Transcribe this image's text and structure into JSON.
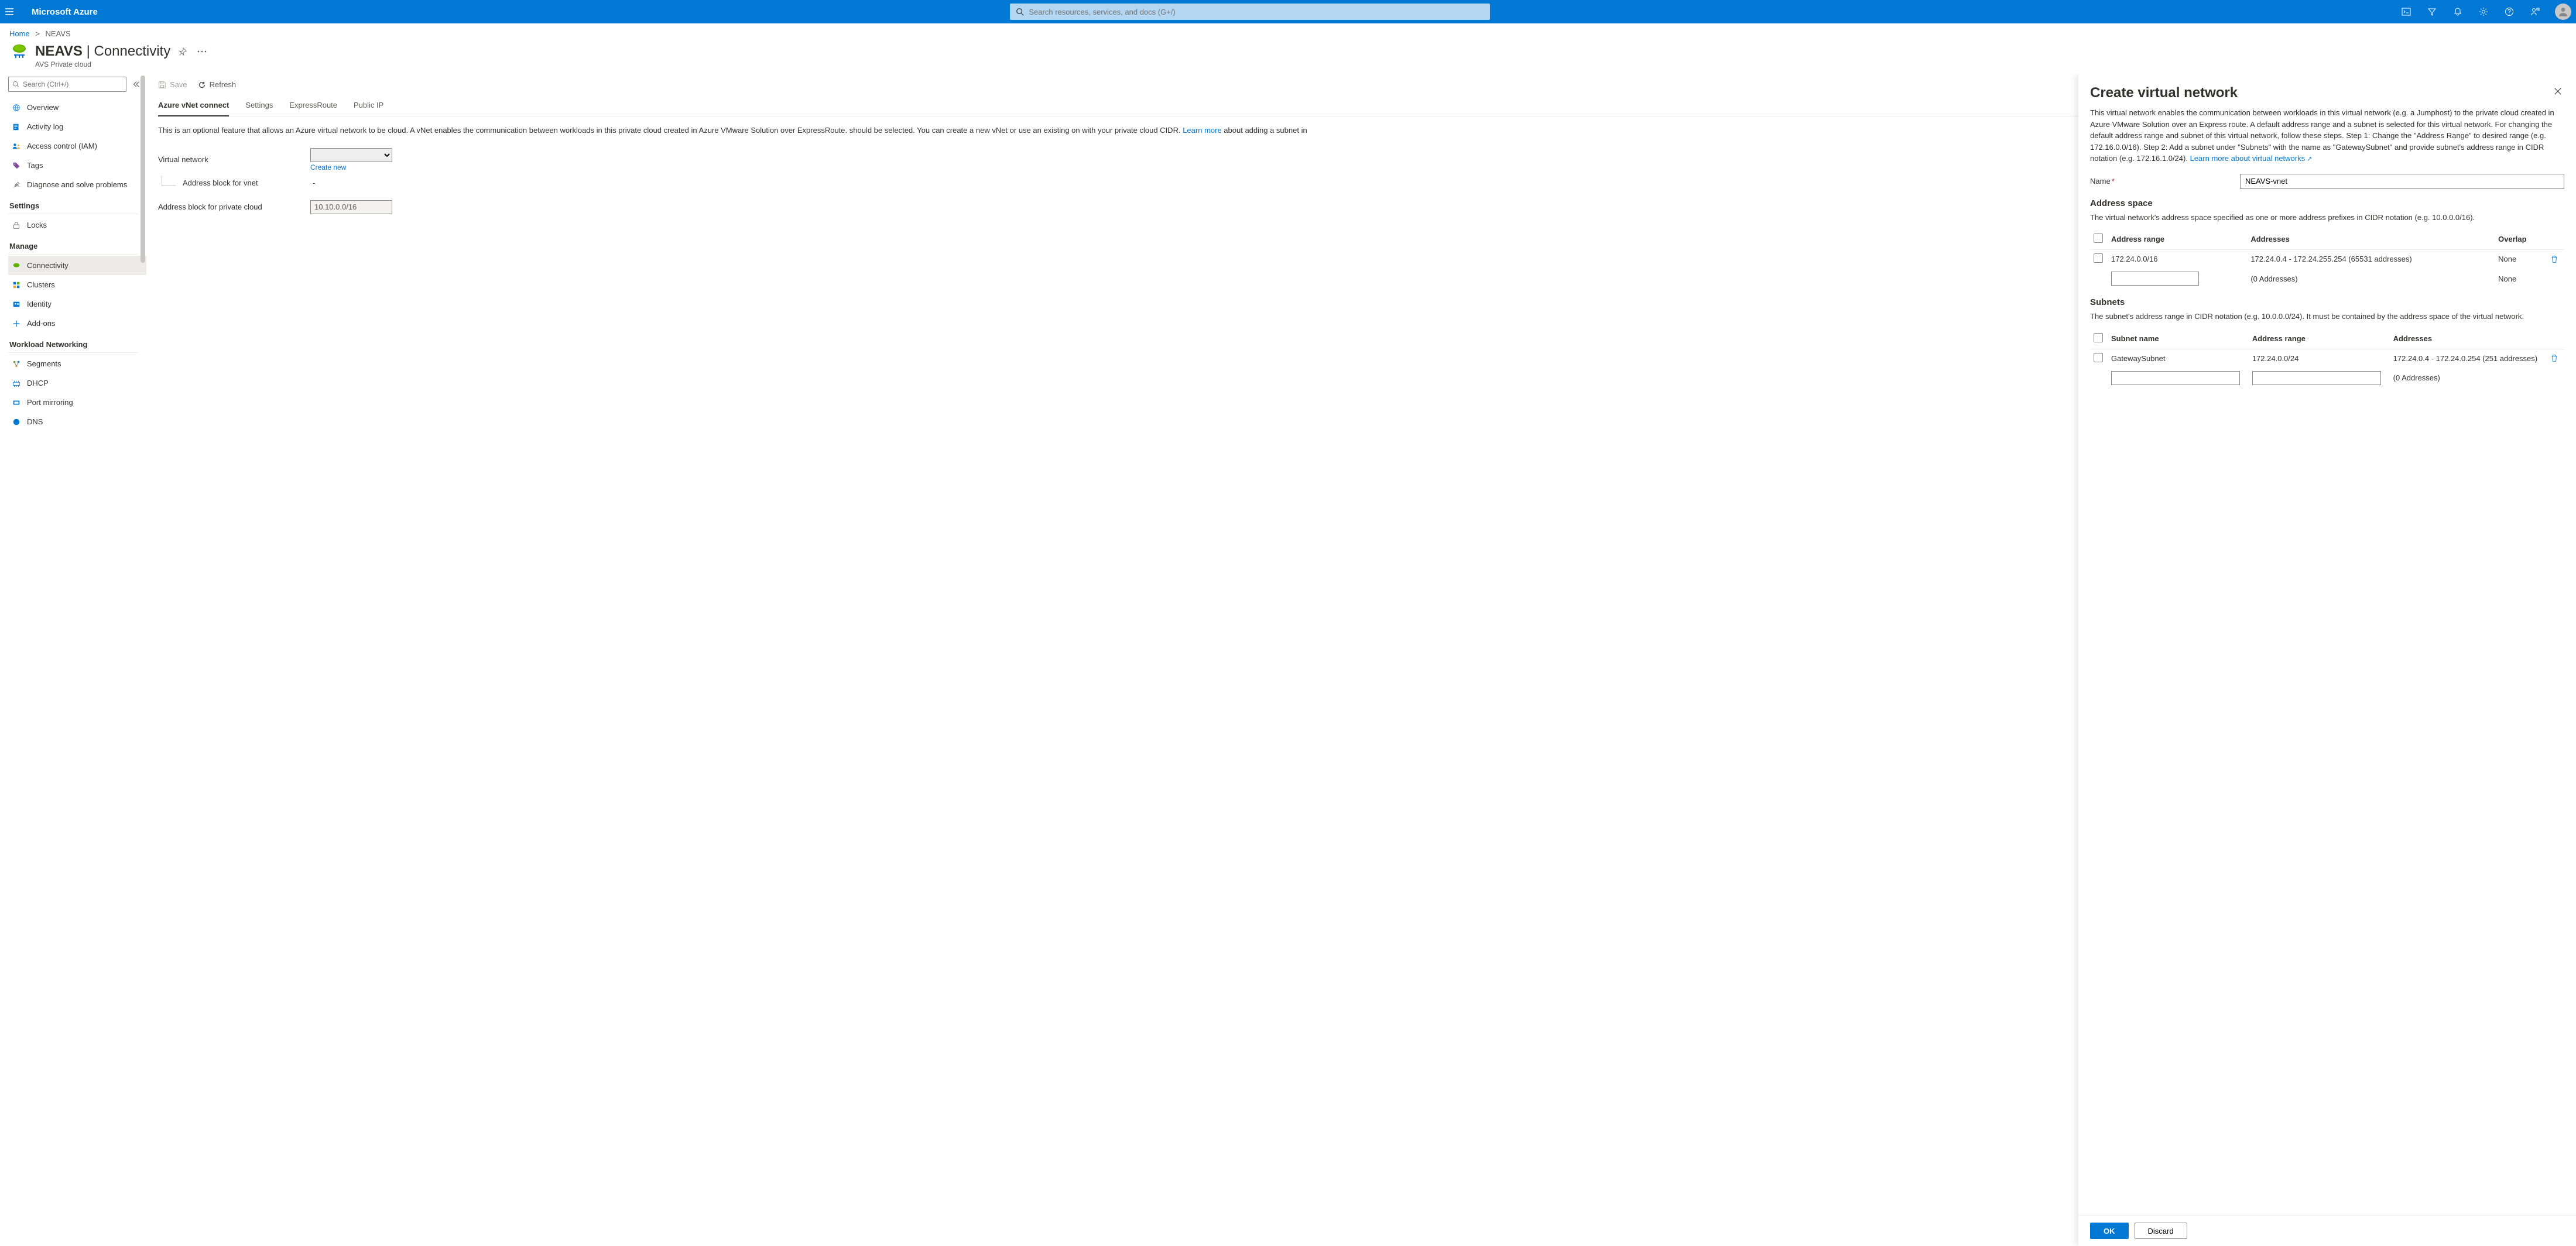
{
  "topbar": {
    "brand": "Microsoft Azure",
    "search_placeholder": "Search resources, services, and docs (G+/)"
  },
  "breadcrumb": {
    "home": "Home",
    "current": "NEAVS"
  },
  "page": {
    "title_primary": "NEAVS",
    "title_secondary": "Connectivity",
    "subtitle": "AVS Private cloud"
  },
  "sidebar": {
    "search_placeholder": "Search (Ctrl+/)",
    "top": [
      {
        "label": "Overview",
        "icon": "globe"
      },
      {
        "label": "Activity log",
        "icon": "log"
      },
      {
        "label": "Access control (IAM)",
        "icon": "iam"
      },
      {
        "label": "Tags",
        "icon": "tags"
      },
      {
        "label": "Diagnose and solve problems",
        "icon": "diagnose"
      }
    ],
    "settings_hdr": "Settings",
    "settings": [
      {
        "label": "Locks",
        "icon": "lock"
      }
    ],
    "manage_hdr": "Manage",
    "manage": [
      {
        "label": "Connectivity",
        "icon": "cloud",
        "selected": true
      },
      {
        "label": "Clusters",
        "icon": "clusters"
      },
      {
        "label": "Identity",
        "icon": "identity"
      },
      {
        "label": "Add-ons",
        "icon": "plus"
      }
    ],
    "workload_hdr": "Workload Networking",
    "workload": [
      {
        "label": "Segments",
        "icon": "segments"
      },
      {
        "label": "DHCP",
        "icon": "dhcp"
      },
      {
        "label": "Port mirroring",
        "icon": "mirror"
      },
      {
        "label": "DNS",
        "icon": "dns"
      }
    ]
  },
  "center": {
    "cmd_save": "Save",
    "cmd_refresh": "Refresh",
    "tabs": [
      "Azure vNet connect",
      "Settings",
      "ExpressRoute",
      "Public IP"
    ],
    "active_tab": "Azure vNet connect",
    "description": "This is an optional feature that allows an Azure virtual network to be cloud. A vNet enables the communication between workloads in this private cloud created in Azure VMware Solution over ExpressRoute. should be selected. You can create a new vNet or use an existing on with your private cloud CIDR.",
    "learn_more": "Learn more",
    "desc_tail": " about adding a subnet in",
    "vnet_label": "Virtual network",
    "create_new": "Create new",
    "addr_block_vnet_label": "Address block for vnet",
    "addr_block_vnet_value": "-",
    "addr_block_pc_label": "Address block for private cloud",
    "addr_block_pc_value": "10.10.0.0/16"
  },
  "blade": {
    "title": "Create virtual network",
    "intro": "This virtual network enables the communication between workloads in this virtual network (e.g. a Jumphost) to the private cloud created in Azure VMware Solution over an Express route. A default address range and a subnet is selected for this virtual network. For changing the default address range and subnet of this virtual network, follow these steps. Step 1: Change the \"Address Range\" to desired range (e.g. 172.16.0.0/16). Step 2: Add a subnet under \"Subnets\" with the name as \"GatewaySubnet\" and provide subnet's address range in CIDR notation (e.g. 172.16.1.0/24). ",
    "learn_more": "Learn more about virtual networks",
    "name_label": "Name",
    "name_value": "NEAVS-vnet",
    "addr_space_hdr": "Address space",
    "addr_space_desc": "The virtual network's address space specified as one or more address prefixes in CIDR notation (e.g. 10.0.0.0/16).",
    "addr_cols": {
      "range": "Address range",
      "addresses": "Addresses",
      "overlap": "Overlap"
    },
    "addr_rows": [
      {
        "range": "172.24.0.0/16",
        "addresses": "172.24.0.4 - 172.24.255.254 (65531 addresses)",
        "overlap": "None",
        "deletable": true
      },
      {
        "range": "",
        "addresses": "(0 Addresses)",
        "overlap": "None",
        "input": true
      }
    ],
    "subnets_hdr": "Subnets",
    "subnets_desc": "The subnet's address range in CIDR notation (e.g. 10.0.0.0/24). It must be contained by the address space of the virtual network.",
    "subnet_cols": {
      "name": "Subnet name",
      "range": "Address range",
      "addresses": "Addresses"
    },
    "subnet_rows": [
      {
        "name": "GatewaySubnet",
        "range": "172.24.0.0/24",
        "addresses": "172.24.0.4 - 172.24.0.254 (251 addresses)",
        "deletable": true
      },
      {
        "name": "",
        "range": "",
        "addresses": "(0 Addresses)",
        "input": true
      }
    ],
    "ok": "OK",
    "discard": "Discard"
  }
}
